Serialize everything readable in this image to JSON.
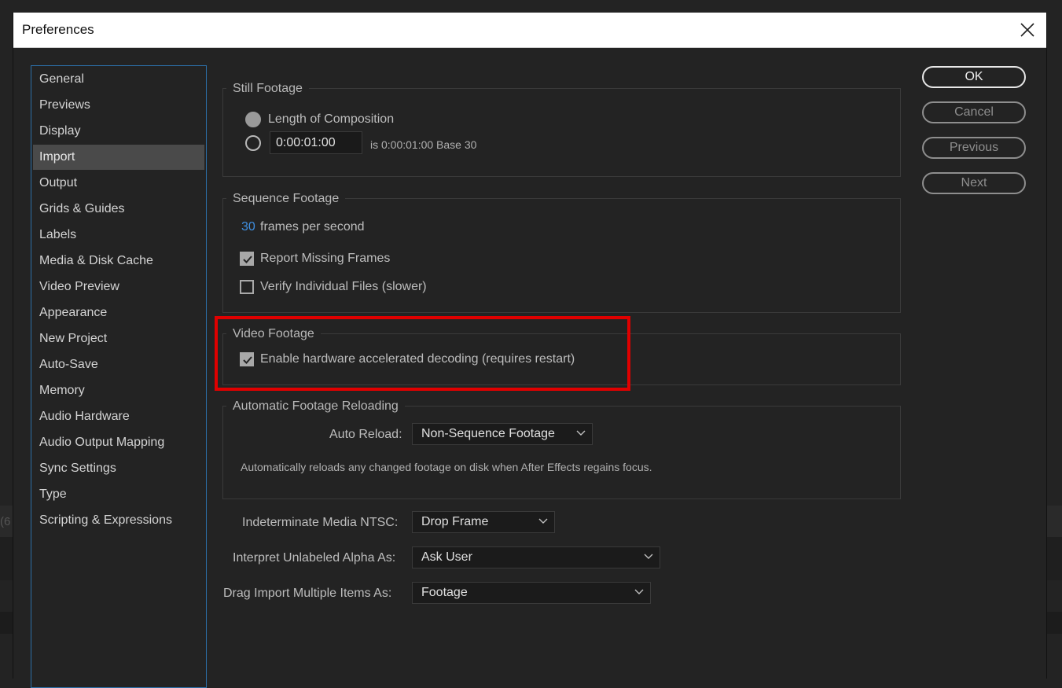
{
  "window": {
    "title": "Preferences"
  },
  "background": {
    "left_fragment": "(6"
  },
  "sidebar": {
    "items": [
      {
        "label": "General"
      },
      {
        "label": "Previews"
      },
      {
        "label": "Display"
      },
      {
        "label": "Import",
        "selected": true
      },
      {
        "label": "Output"
      },
      {
        "label": "Grids & Guides"
      },
      {
        "label": "Labels"
      },
      {
        "label": "Media & Disk Cache"
      },
      {
        "label": "Video Preview"
      },
      {
        "label": "Appearance"
      },
      {
        "label": "New Project"
      },
      {
        "label": "Auto-Save"
      },
      {
        "label": "Memory"
      },
      {
        "label": "Audio Hardware"
      },
      {
        "label": "Audio Output Mapping"
      },
      {
        "label": "Sync Settings"
      },
      {
        "label": "Type"
      },
      {
        "label": "Scripting & Expressions"
      }
    ]
  },
  "still_footage": {
    "title": "Still Footage",
    "option_length": "Length of Composition",
    "duration_value": "0:00:01:00",
    "duration_info": "is 0:00:01:00  Base 30",
    "selected": "Length of Composition"
  },
  "sequence_footage": {
    "title": "Sequence Footage",
    "fps_value": "30",
    "fps_label": "frames per second",
    "report_missing": "Report Missing Frames",
    "report_missing_checked": true,
    "verify_files": "Verify Individual Files (slower)",
    "verify_files_checked": false
  },
  "video_footage": {
    "title": "Video Footage",
    "hw_decoding": "Enable hardware accelerated decoding (requires restart)",
    "hw_decoding_checked": true
  },
  "auto_reload": {
    "title": "Automatic Footage Reloading",
    "label": "Auto Reload:",
    "value": "Non-Sequence Footage",
    "description": "Automatically reloads any changed footage on disk when After Effects regains focus."
  },
  "settings": {
    "ntsc_label": "Indeterminate Media NTSC:",
    "ntsc_value": "Drop Frame",
    "alpha_label": "Interpret Unlabeled Alpha As:",
    "alpha_value": "Ask User",
    "drag_label": "Drag Import Multiple Items As:",
    "drag_value": "Footage"
  },
  "buttons": {
    "ok": "OK",
    "cancel": "Cancel",
    "previous": "Previous",
    "next": "Next"
  },
  "colors": {
    "accent_blue": "#3f8fe0",
    "highlight_red": "#e00000"
  }
}
